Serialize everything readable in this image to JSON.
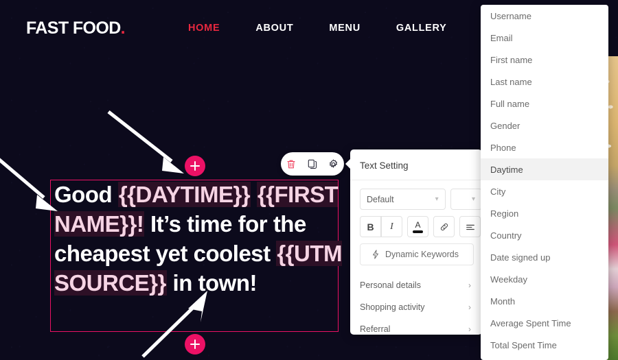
{
  "site": {
    "logo_text": "FAST FOOD",
    "logo_dot": ".",
    "nav": [
      {
        "label": "HOME",
        "active": true
      },
      {
        "label": "ABOUT",
        "active": false
      },
      {
        "label": "MENU",
        "active": false
      },
      {
        "label": "GALLERY",
        "active": false
      }
    ]
  },
  "headline": {
    "parts": [
      {
        "text": "Good ",
        "token": false
      },
      {
        "text": "{{DAYTIME}}",
        "token": true
      },
      {
        "text": " ",
        "token": false
      },
      {
        "text": "{{FIRST NAME}}!",
        "token": true
      },
      {
        "text": " It’s time for the cheapest yet coolest ",
        "token": false
      },
      {
        "text": "{{UTM SOURCE}}",
        "token": true
      },
      {
        "text": " in town!",
        "token": false
      }
    ],
    "plain": "Good {{DAYTIME}} {{FIRST NAME}}! It’s time for the cheapest yet coolest {{UTM SOURCE}} in town!"
  },
  "element_toolbar": {
    "buttons": [
      {
        "name": "delete-icon",
        "glyph": "⌧"
      },
      {
        "name": "duplicate-icon",
        "glyph": "❐"
      },
      {
        "name": "settings-icon",
        "glyph": "⚙"
      }
    ]
  },
  "add_buttons": {
    "top_label": "+",
    "bottom_label": "+"
  },
  "text_setting": {
    "title": "Text Setting",
    "font_select": {
      "value": "Default"
    },
    "size_select": {
      "value": ""
    },
    "format_buttons": [
      {
        "name": "bold-button",
        "label": "B"
      },
      {
        "name": "italic-button",
        "label": "I"
      },
      {
        "name": "text-color-button",
        "label": "A"
      },
      {
        "name": "link-button",
        "label": "ὑ7"
      },
      {
        "name": "align-button",
        "label": "≡"
      }
    ],
    "dynamic_keywords_button": "Dynamic Keywords",
    "submenu": [
      {
        "label": "Personal details",
        "arrow": "›"
      },
      {
        "label": "Shopping activity",
        "arrow": "›"
      },
      {
        "label": "Referral",
        "arrow": "›"
      }
    ]
  },
  "keywords_menu": {
    "items": [
      {
        "label": "Username",
        "hover": false
      },
      {
        "label": "Email",
        "hover": false
      },
      {
        "label": "First name",
        "hover": false
      },
      {
        "label": "Last name",
        "hover": false
      },
      {
        "label": "Full name",
        "hover": false
      },
      {
        "label": "Gender",
        "hover": false
      },
      {
        "label": "Phone",
        "hover": false
      },
      {
        "label": "Daytime",
        "hover": true
      },
      {
        "label": "City",
        "hover": false
      },
      {
        "label": "Region",
        "hover": false
      },
      {
        "label": "Country",
        "hover": false
      },
      {
        "label": "Date signed up",
        "hover": false
      },
      {
        "label": "Weekday",
        "hover": false
      },
      {
        "label": "Month",
        "hover": false
      },
      {
        "label": "Average Spent Time",
        "hover": false
      },
      {
        "label": "Total Spent Time",
        "hover": false
      }
    ]
  },
  "colors": {
    "accent_pink": "#ec1165",
    "accent_red": "#e8283f",
    "page_bg": "#0c0a1c",
    "token_bg": "#2d1026",
    "token_fg": "#f6d4e4"
  }
}
